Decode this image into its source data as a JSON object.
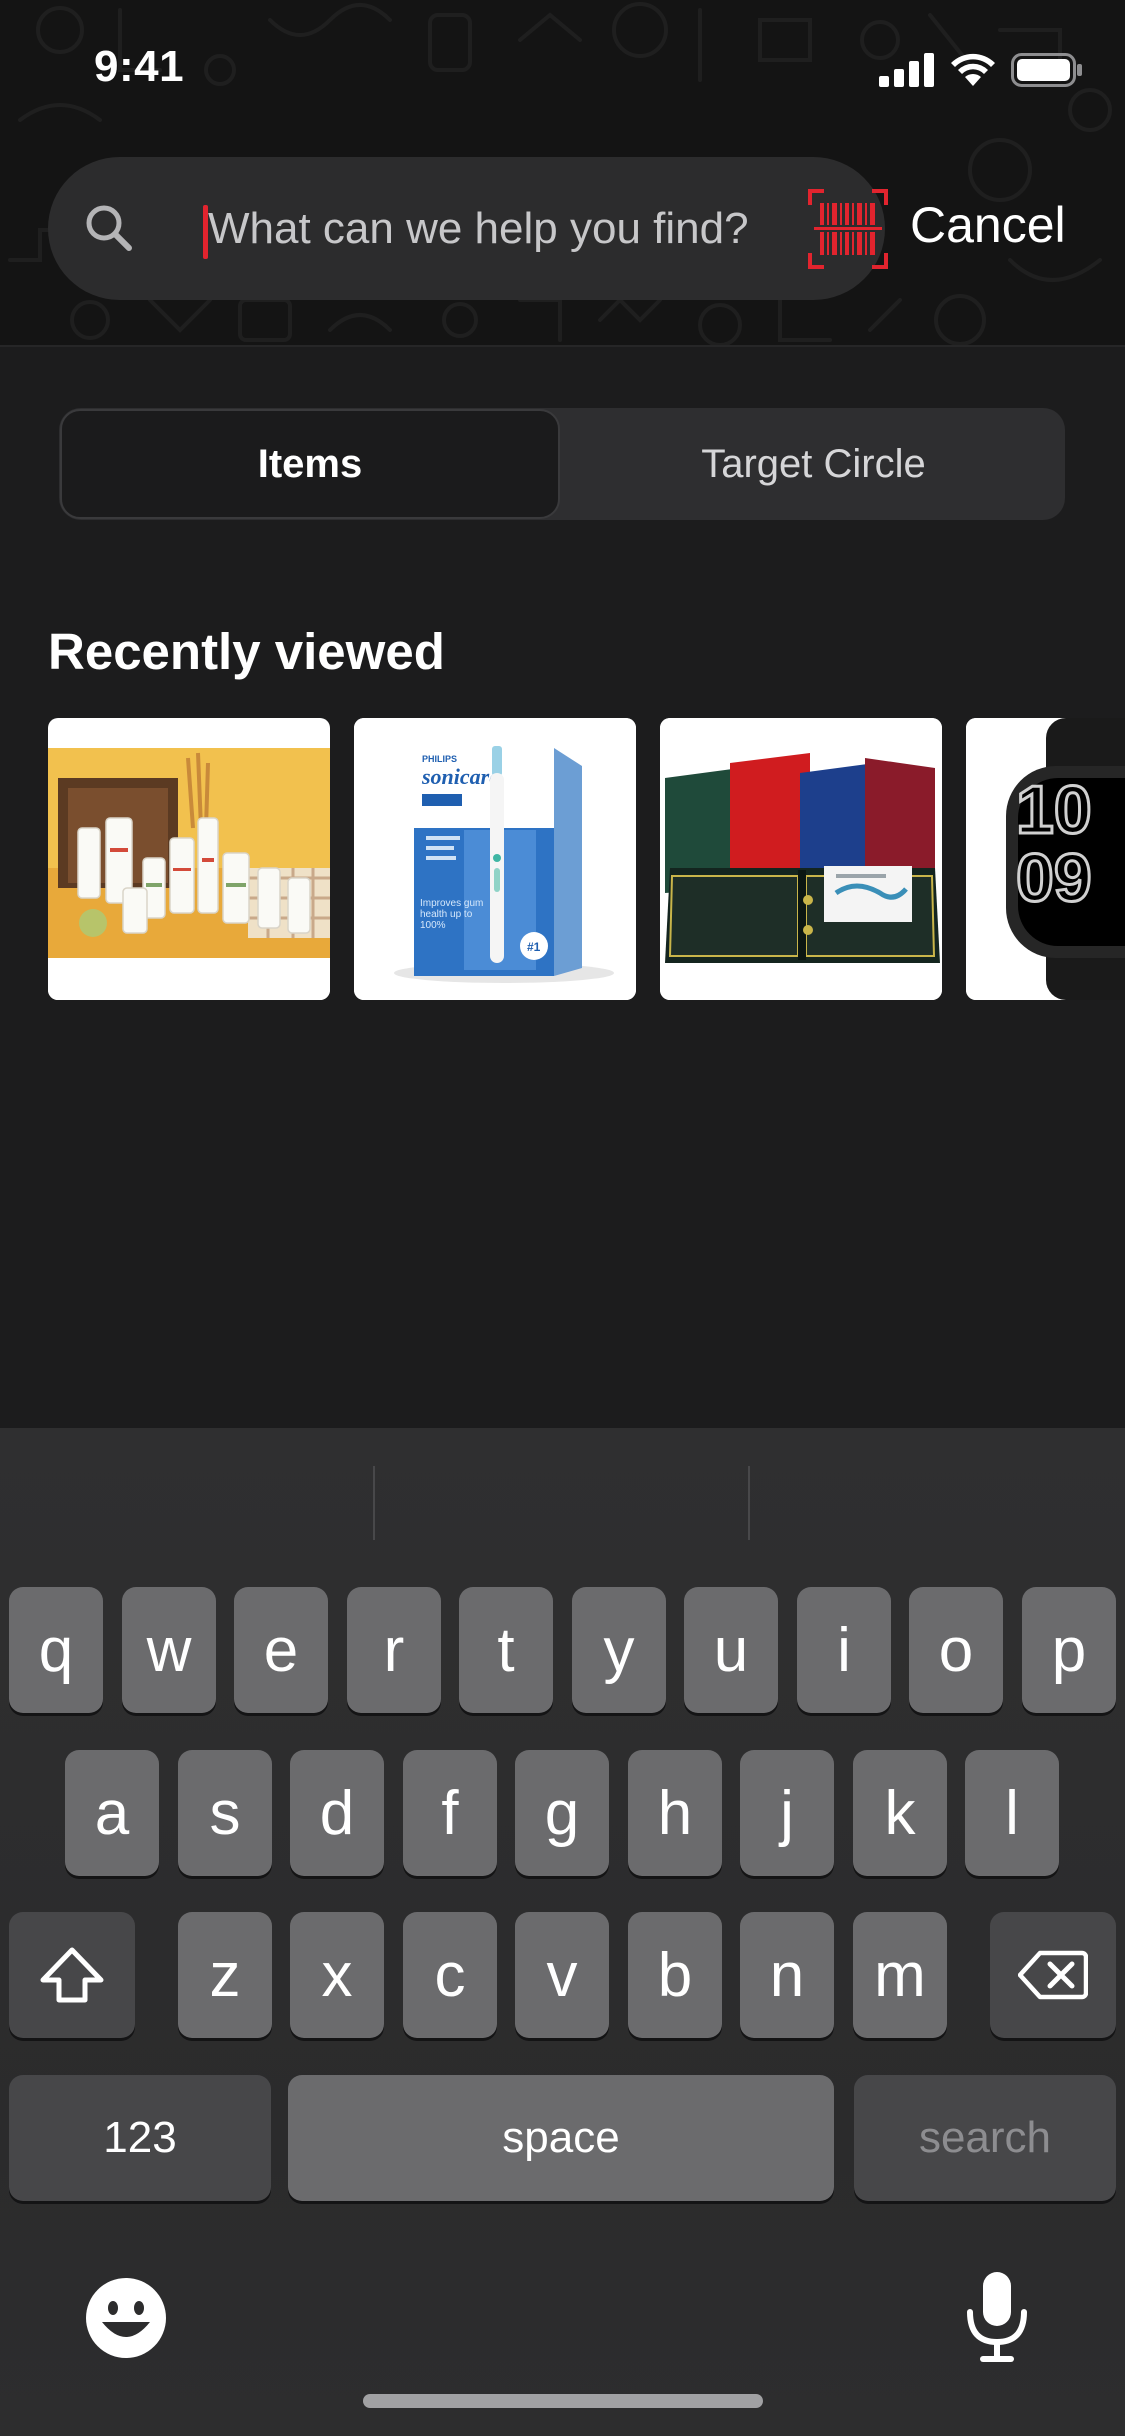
{
  "status_bar": {
    "time": "9:41"
  },
  "search": {
    "placeholder": "What can we help you find?",
    "value": "",
    "icon": "magnifying-glass",
    "barcode_icon": "barcode-scanner",
    "accent_color": "#e2242e"
  },
  "header": {
    "cancel_label": "Cancel"
  },
  "tabs": [
    {
      "label": "Items",
      "selected": true
    },
    {
      "label": "Target Circle",
      "selected": false
    }
  ],
  "recently_viewed": {
    "title": "Recently viewed",
    "items": [
      {
        "image": "hair-care-product-set"
      },
      {
        "image": "philips-sonicare-toothbrush-box",
        "box_text": [
          "PHILIPS",
          "sonicare",
          "Improves gum health up to 100%"
        ]
      },
      {
        "image": "presentation-binders"
      },
      {
        "image": "smartwatch",
        "face_text": "10 09"
      }
    ]
  },
  "keyboard": {
    "row1": [
      "q",
      "w",
      "e",
      "r",
      "t",
      "y",
      "u",
      "i",
      "o",
      "p"
    ],
    "row2": [
      "a",
      "s",
      "d",
      "f",
      "g",
      "h",
      "j",
      "k",
      "l"
    ],
    "row3": [
      "z",
      "x",
      "c",
      "v",
      "b",
      "n",
      "m"
    ],
    "numbers_label": "123",
    "space_label": "space",
    "return_label": "search",
    "shift_icon": "shift-arrow",
    "delete_icon": "backspace",
    "emoji_icon": "emoji-face",
    "mic_icon": "microphone"
  }
}
